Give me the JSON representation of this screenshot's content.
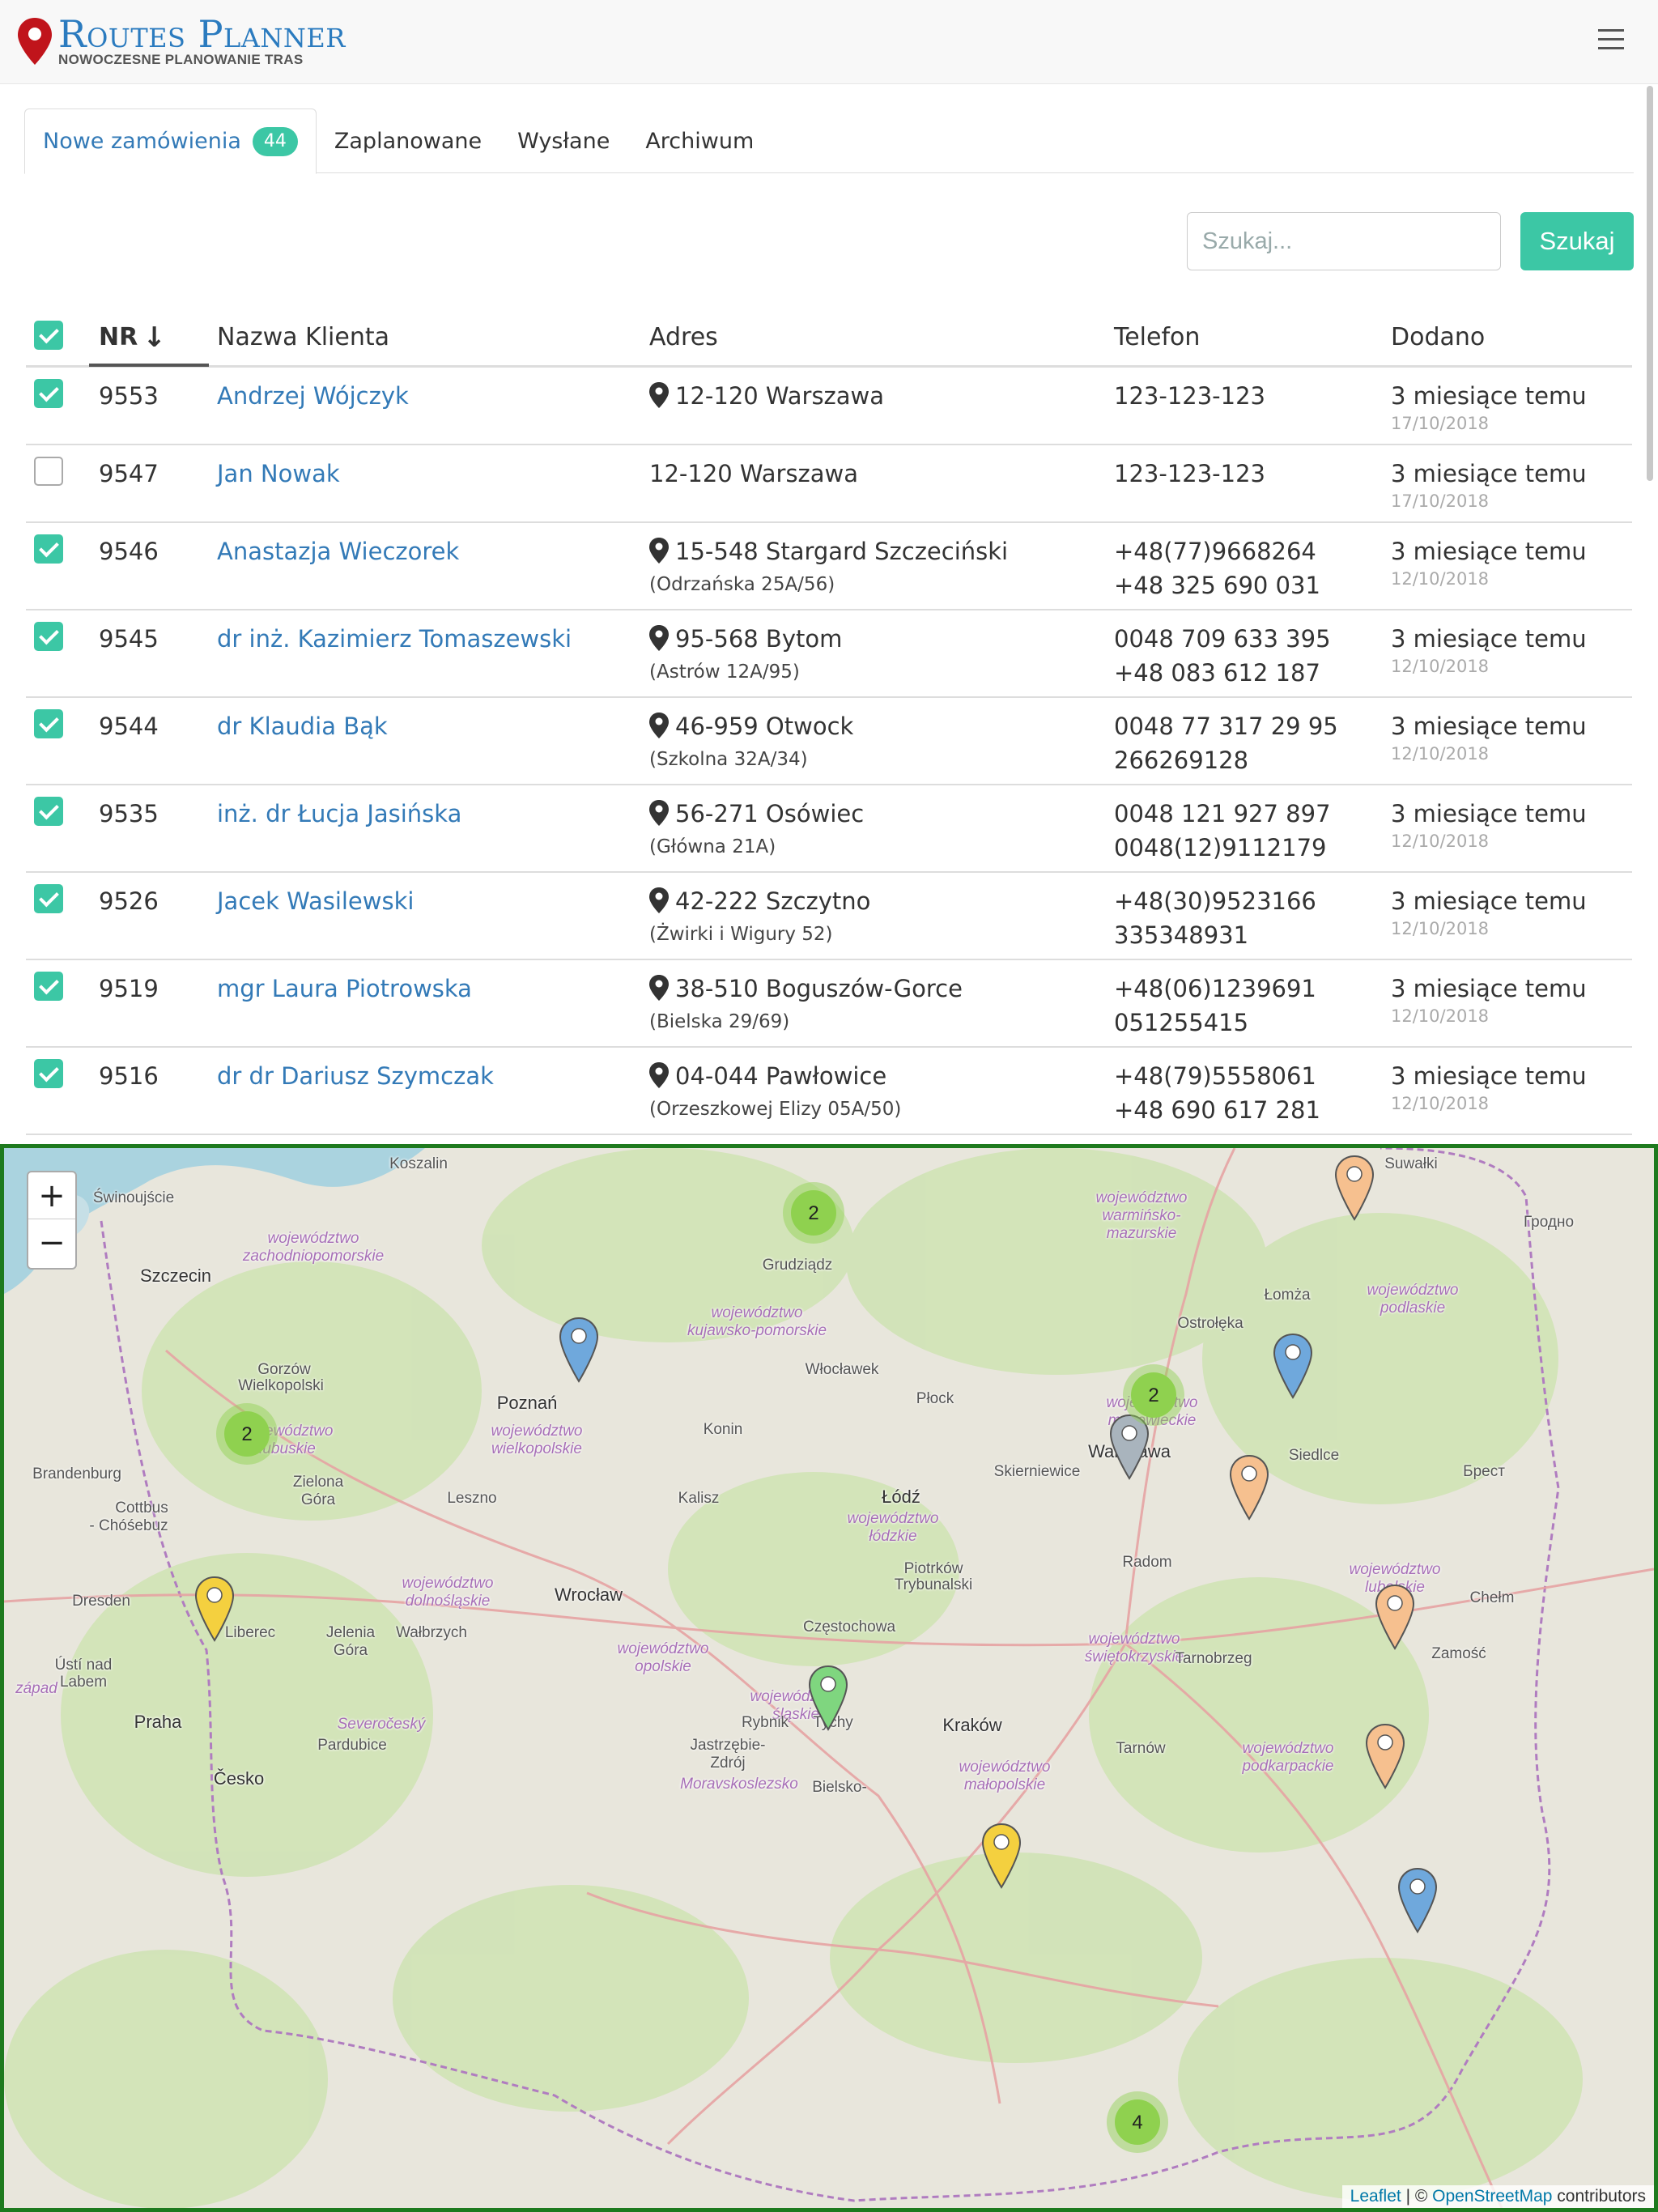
{
  "app": {
    "brand": "Routes Planner",
    "tagline": "NOWOCZESNE PLANOWANIE TRAS"
  },
  "tabs": [
    {
      "label": "Nowe zamówienia",
      "badge": "44"
    },
    {
      "label": "Zaplanowane"
    },
    {
      "label": "Wysłane"
    },
    {
      "label": "Archiwum"
    }
  ],
  "search": {
    "placeholder": "Szukaj...",
    "button": "Szukaj"
  },
  "table": {
    "headers": {
      "nr": "NR",
      "name": "Nazwa Klienta",
      "address": "Adres",
      "phone": "Telefon",
      "added": "Dodano"
    },
    "rows": [
      {
        "checked": true,
        "nr": "9553",
        "name": "Andrzej Wójczyk",
        "city": "12-120 Warszawa",
        "street": "",
        "has_pin": true,
        "phone1": "123-123-123",
        "phone2": "",
        "ago": "3 miesiące temu",
        "date": "17/10/2018"
      },
      {
        "checked": false,
        "nr": "9547",
        "name": "Jan Nowak",
        "city": "12-120 Warszawa",
        "street": "",
        "has_pin": false,
        "phone1": "123-123-123",
        "phone2": "",
        "ago": "3 miesiące temu",
        "date": "17/10/2018"
      },
      {
        "checked": true,
        "nr": "9546",
        "name": "Anastazja Wieczorek",
        "city": "15-548 Stargard Szczeciński",
        "street": "(Odrzańska 25A/56)",
        "has_pin": true,
        "phone1": "+48(77)9668264",
        "phone2": "+48 325 690 031",
        "ago": "3 miesiące temu",
        "date": "12/10/2018"
      },
      {
        "checked": true,
        "nr": "9545",
        "name": "dr inż. Kazimierz Tomaszewski",
        "city": "95-568 Bytom",
        "street": "(Astrów 12A/95)",
        "has_pin": true,
        "phone1": "0048 709 633 395",
        "phone2": "+48 083 612 187",
        "ago": "3 miesiące temu",
        "date": "12/10/2018"
      },
      {
        "checked": true,
        "nr": "9544",
        "name": "dr Klaudia Bąk",
        "city": "46-959 Otwock",
        "street": "(Szkolna 32A/34)",
        "has_pin": true,
        "phone1": "0048 77 317 29 95",
        "phone2": "266269128",
        "ago": "3 miesiące temu",
        "date": "12/10/2018"
      },
      {
        "checked": true,
        "nr": "9535",
        "name": "inż. dr Łucja Jasińska",
        "city": "56-271 Osówiec",
        "street": "(Główna 21A)",
        "has_pin": true,
        "phone1": "0048 121 927 897",
        "phone2": "0048(12)9112179",
        "ago": "3 miesiące temu",
        "date": "12/10/2018"
      },
      {
        "checked": true,
        "nr": "9526",
        "name": "Jacek Wasilewski",
        "city": "42-222 Szczytno",
        "street": "(Żwirki i Wigury 52)",
        "has_pin": true,
        "phone1": "+48(30)9523166",
        "phone2": "335348931",
        "ago": "3 miesiące temu",
        "date": "12/10/2018"
      },
      {
        "checked": true,
        "nr": "9519",
        "name": "mgr Laura Piotrowska",
        "city": "38-510 Boguszów-Gorce",
        "street": "(Bielska 29/69)",
        "has_pin": true,
        "phone1": "+48(06)1239691",
        "phone2": "051255415",
        "ago": "3 miesiące temu",
        "date": "12/10/2018"
      },
      {
        "checked": true,
        "nr": "9516",
        "name": "dr dr Dariusz Szymczak",
        "city": "04-044 Pawłowice",
        "street": "(Orzeszkowej Elizy 05A/50)",
        "has_pin": true,
        "phone1": "+48(79)5558061",
        "phone2": "+48 690 617 281",
        "ago": "3 miesiące temu",
        "date": "12/10/2018"
      }
    ]
  },
  "map": {
    "zoom_in": "+",
    "zoom_out": "−",
    "attribution": {
      "leaflet": "Leaflet",
      "sep": " | © ",
      "osm": "OpenStreetMap",
      "suffix": " contributors"
    },
    "labels": [
      {
        "text": "Koszalin"
      },
      {
        "text": "Świnoujście"
      },
      {
        "text": "Suwałki"
      },
      {
        "text": "województwo"
      },
      {
        "text": "zachodniopomorskie"
      },
      {
        "text": "województwo"
      },
      {
        "text": "warmińsko-"
      },
      {
        "text": "mazurskie"
      },
      {
        "text": "Гродно"
      },
      {
        "text": "Szczecin"
      },
      {
        "text": "Grudziądz"
      },
      {
        "text": "Łomża"
      },
      {
        "text": "województwo"
      },
      {
        "text": "podlaskie"
      },
      {
        "text": "województwo"
      },
      {
        "text": "kujawsko-pomorskie"
      },
      {
        "text": "Ostrołęka"
      },
      {
        "text": "Gorzów"
      },
      {
        "text": "Wielkopolski"
      },
      {
        "text": "Włocławek"
      },
      {
        "text": "Poznań"
      },
      {
        "text": "Płock"
      },
      {
        "text": "województwo"
      },
      {
        "text": "mazowieckie"
      },
      {
        "text": "województwo"
      },
      {
        "text": "lubuskie"
      },
      {
        "text": "województwo"
      },
      {
        "text": "wielkopolskie"
      },
      {
        "text": "Konin"
      },
      {
        "text": "Warszawa"
      },
      {
        "text": "Siedlce"
      },
      {
        "text": "Brandenburg"
      },
      {
        "text": "Zielona"
      },
      {
        "text": "Góra"
      },
      {
        "text": "Skierniewice"
      },
      {
        "text": "Брест"
      },
      {
        "text": "Cottbus"
      },
      {
        "text": "- Chóśebuz"
      },
      {
        "text": "Leszno"
      },
      {
        "text": "Kalisz"
      },
      {
        "text": "Łódź"
      },
      {
        "text": "województwo"
      },
      {
        "text": "łódzkie"
      },
      {
        "text": "Radom"
      },
      {
        "text": "Piotrków"
      },
      {
        "text": "Trybunalski"
      },
      {
        "text": "województwo"
      },
      {
        "text": "lubelskie"
      },
      {
        "text": "województwo"
      },
      {
        "text": "dolnośląskie"
      },
      {
        "text": "Wrocław"
      },
      {
        "text": "Chełm"
      },
      {
        "text": "Dresden"
      },
      {
        "text": "Liberec"
      },
      {
        "text": "Jelenia"
      },
      {
        "text": "Góra"
      },
      {
        "text": "Wałbrzych"
      },
      {
        "text": "Częstochowa"
      },
      {
        "text": "województwo"
      },
      {
        "text": "świętokrzyskie"
      },
      {
        "text": "województwo"
      },
      {
        "text": "opolskie"
      },
      {
        "text": "Tarnobrzeg"
      },
      {
        "text": "Zamość"
      },
      {
        "text": "Ústí nad"
      },
      {
        "text": "Labem"
      },
      {
        "text": "západ"
      },
      {
        "text": "województwo"
      },
      {
        "text": "śląskie"
      },
      {
        "text": "Kraków"
      },
      {
        "text": "Rybnik"
      },
      {
        "text": "Tychy"
      },
      {
        "text": "Praha"
      },
      {
        "text": "Severočeský"
      },
      {
        "text": "Tarnów"
      },
      {
        "text": "województwo"
      },
      {
        "text": "podkarpackie"
      },
      {
        "text": "Jastrzębie-"
      },
      {
        "text": "Zdrój"
      },
      {
        "text": "Pardubice"
      },
      {
        "text": "Česko"
      },
      {
        "text": "województwo"
      },
      {
        "text": "małopolskie"
      },
      {
        "text": "Moravskoslezsko"
      },
      {
        "text": "Bielsko-"
      }
    ],
    "clusters": [
      {
        "count": "2"
      },
      {
        "count": "2"
      },
      {
        "count": "2"
      },
      {
        "count": "4"
      }
    ],
    "colors": {
      "cluster": "#8fd14f",
      "blue": "#6fa8dc",
      "orange": "#f6c08f",
      "yellow": "#f4d03f",
      "gray": "#a9b4bd",
      "green": "#7fd67f"
    }
  }
}
